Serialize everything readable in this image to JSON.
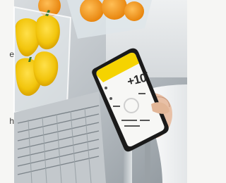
{
  "scene": {
    "caption_fragments": [
      "e",
      "h"
    ],
    "phone_display": {
      "temperature": "+10",
      "degree_symbol": "°"
    },
    "colors": {
      "pepper_yellow": "#f2c50c",
      "pepper_orange": "#f39a1a",
      "phone_accent": "#f5d300",
      "steel": "#c9cdd0"
    },
    "icons": [
      "yellow-pepper",
      "smartphone",
      "hand",
      "fridge-shelf"
    ]
  }
}
